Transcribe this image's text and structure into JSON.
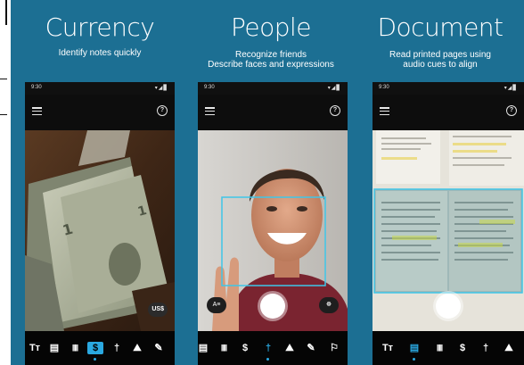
{
  "colors": {
    "banner": "#1c6f93",
    "accent": "#2aa8e0",
    "phone": "#000000",
    "box": "#3ec6e8"
  },
  "status": {
    "time": "9:30",
    "signal": "▾◢▊"
  },
  "help_glyph": "?",
  "panels": [
    {
      "title": "Currency",
      "subtitle_lines": [
        "Identify notes quickly"
      ],
      "currency_badge": "US$",
      "tools": [
        {
          "label": "Tт",
          "icon": "short-text-icon",
          "active": false
        },
        {
          "label": "▤",
          "icon": "document-icon",
          "active": false
        },
        {
          "label": "|||||",
          "icon": "barcode-icon",
          "active": false
        },
        {
          "label": "$",
          "icon": "currency-icon",
          "active": true
        },
        {
          "label": "†",
          "icon": "person-icon",
          "active": false
        },
        {
          "label": "⛰",
          "icon": "scene-icon",
          "active": false
        },
        {
          "label": "✎",
          "icon": "handwriting-icon",
          "active": false
        }
      ]
    },
    {
      "title": "People",
      "subtitle_lines": [
        "Recognize friends",
        "Describe faces and expressions"
      ],
      "left_chip": "A≡",
      "right_chip": "☸",
      "tools": [
        {
          "label": "▤",
          "icon": "document-icon",
          "active": false
        },
        {
          "label": "|||||",
          "icon": "barcode-icon",
          "active": false
        },
        {
          "label": "$",
          "icon": "currency-icon",
          "active": false
        },
        {
          "label": "†",
          "icon": "person-icon",
          "active": true
        },
        {
          "label": "⛰",
          "icon": "scene-icon",
          "active": false
        },
        {
          "label": "✎",
          "icon": "handwriting-icon",
          "active": false
        },
        {
          "label": "⚐",
          "icon": "color-icon",
          "active": false
        }
      ]
    },
    {
      "title": "Document",
      "subtitle_lines": [
        "Read printed pages using",
        "audio cues to align"
      ],
      "tools": [
        {
          "label": "Tт",
          "icon": "short-text-icon",
          "active": false
        },
        {
          "label": "▤",
          "icon": "document-icon",
          "active": true
        },
        {
          "label": "|||||",
          "icon": "barcode-icon",
          "active": false
        },
        {
          "label": "$",
          "icon": "currency-icon",
          "active": false
        },
        {
          "label": "†",
          "icon": "person-icon",
          "active": false
        },
        {
          "label": "⛰",
          "icon": "scene-icon",
          "active": false
        }
      ]
    }
  ]
}
